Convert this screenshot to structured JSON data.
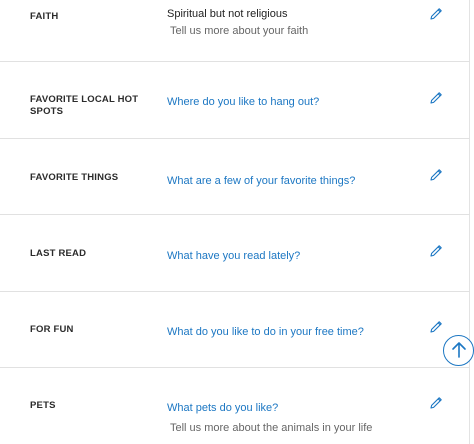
{
  "rows": [
    {
      "label": "FAITH",
      "value": "Spiritual but not religious",
      "subtext": "Tell us more about your faith"
    },
    {
      "label": "FAVORITE LOCAL HOT SPOTS",
      "prompt": "Where do you like to hang out?"
    },
    {
      "label": "FAVORITE THINGS",
      "prompt": "What are a few of your favorite things?"
    },
    {
      "label": "LAST READ",
      "prompt": "What have you read lately?"
    },
    {
      "label": "FOR FUN",
      "prompt": "What do you like to do in your free time?"
    },
    {
      "label": "PETS",
      "prompt": "What pets do you like?",
      "subtext": "Tell us more about the animals in your life"
    }
  ],
  "icons": {
    "edit": "pencil-icon",
    "scroll_top": "arrow-up-icon"
  },
  "colors": {
    "accent": "#1c77c3",
    "label": "#2b2b2b",
    "divider": "#e1e1e1"
  }
}
